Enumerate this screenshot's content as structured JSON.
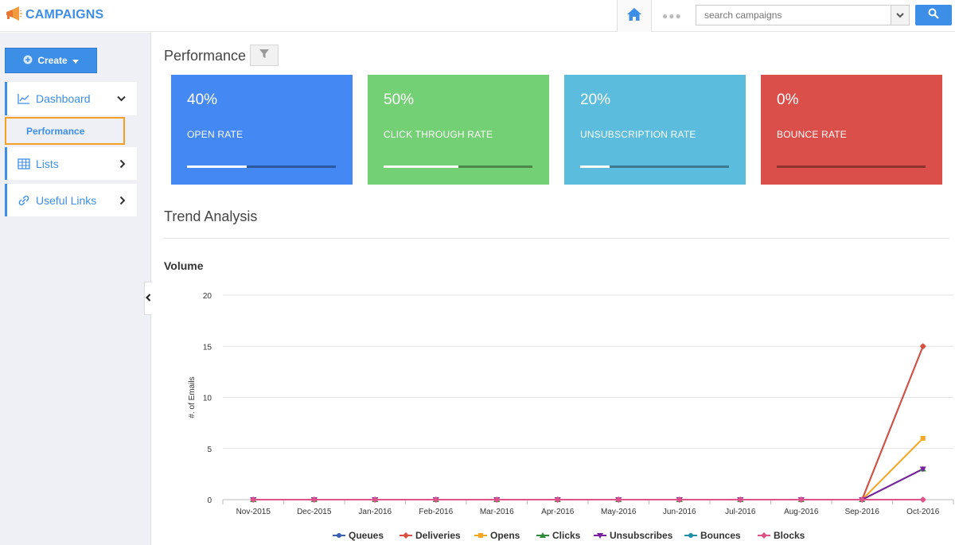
{
  "app": {
    "title": "CAMPAIGNS"
  },
  "search": {
    "placeholder": "search campaigns"
  },
  "sidebar": {
    "create_label": "Create",
    "items": [
      {
        "label": "Dashboard"
      },
      {
        "label": "Lists"
      },
      {
        "label": "Useful Links"
      }
    ],
    "subitem": {
      "label": "Performance"
    }
  },
  "main": {
    "title": "Performance",
    "trend_title": "Trend Analysis",
    "chart_title": "Volume"
  },
  "cards": [
    {
      "value": "40%",
      "label": "OPEN RATE",
      "progress": 0.4,
      "color": "#4488f4"
    },
    {
      "value": "50%",
      "label": "CLICK THROUGH RATE",
      "progress": 0.5,
      "color": "#74d074"
    },
    {
      "value": "20%",
      "label": "UNSUBSCRIPTION RATE",
      "progress": 0.2,
      "color": "#5bbcdd"
    },
    {
      "value": "0%",
      "label": "BOUNCE RATE",
      "progress": 0.0,
      "color": "#da4f4a"
    }
  ],
  "chart_data": {
    "type": "line",
    "title": "Volume",
    "xlabel": "",
    "ylabel": "#. of Emails",
    "ylim": [
      0,
      20
    ],
    "yticks": [
      0,
      5,
      10,
      15,
      20
    ],
    "grid": true,
    "legend_position": "bottom",
    "x": [
      "Nov-2015",
      "Dec-2015",
      "Jan-2016",
      "Feb-2016",
      "Mar-2016",
      "Apr-2016",
      "May-2016",
      "Jun-2016",
      "Jul-2016",
      "Aug-2016",
      "Sep-2016",
      "Oct-2016"
    ],
    "series": [
      {
        "name": "Queues",
        "color": "#3a5fb0",
        "marker": "circle",
        "values": [
          0,
          0,
          0,
          0,
          0,
          0,
          0,
          0,
          0,
          0,
          0,
          15
        ]
      },
      {
        "name": "Deliveries",
        "color": "#d9503f",
        "marker": "diamond",
        "values": [
          0,
          0,
          0,
          0,
          0,
          0,
          0,
          0,
          0,
          0,
          0,
          15
        ]
      },
      {
        "name": "Opens",
        "color": "#f5a623",
        "marker": "square",
        "values": [
          0,
          0,
          0,
          0,
          0,
          0,
          0,
          0,
          0,
          0,
          0,
          6
        ]
      },
      {
        "name": "Clicks",
        "color": "#2e8b3a",
        "marker": "triangle",
        "values": [
          0,
          0,
          0,
          0,
          0,
          0,
          0,
          0,
          0,
          0,
          0,
          3
        ]
      },
      {
        "name": "Unsubscribes",
        "color": "#7b1fa2",
        "marker": "triangle-down",
        "values": [
          0,
          0,
          0,
          0,
          0,
          0,
          0,
          0,
          0,
          0,
          0,
          3
        ]
      },
      {
        "name": "Bounces",
        "color": "#1f8fa8",
        "marker": "circle",
        "values": [
          0,
          0,
          0,
          0,
          0,
          0,
          0,
          0,
          0,
          0,
          0,
          0
        ]
      },
      {
        "name": "Blocks",
        "color": "#e0528a",
        "marker": "diamond",
        "values": [
          0,
          0,
          0,
          0,
          0,
          0,
          0,
          0,
          0,
          0,
          0,
          0
        ]
      }
    ]
  }
}
